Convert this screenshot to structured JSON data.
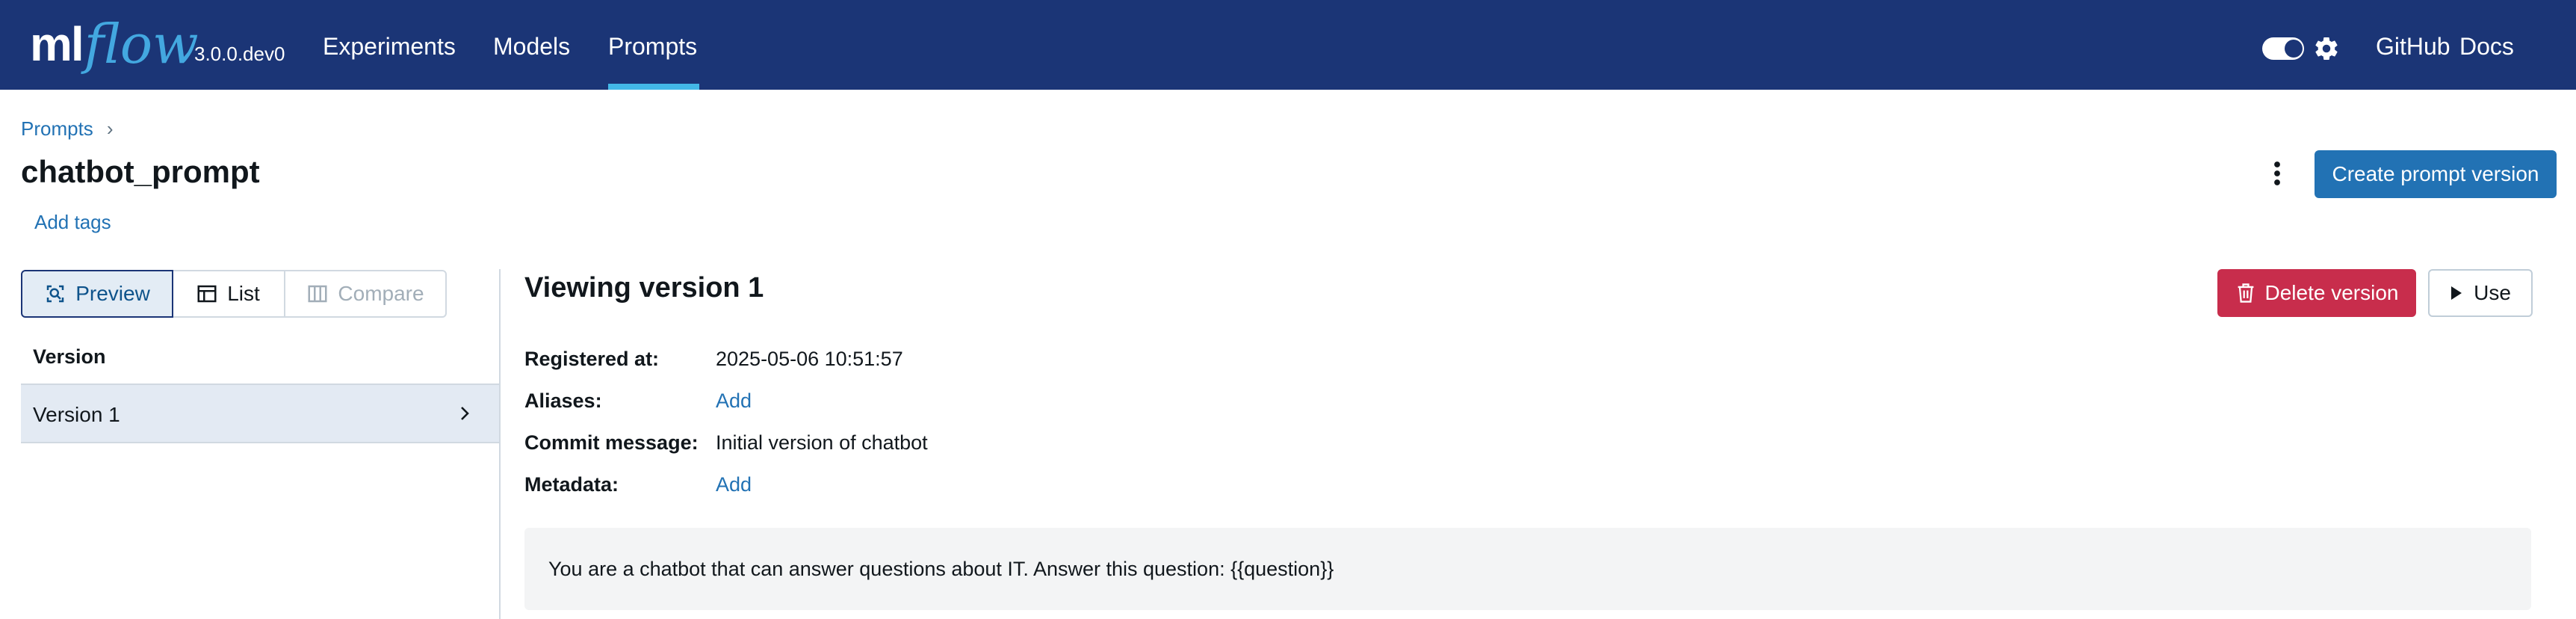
{
  "header": {
    "logo_ml": "ml",
    "logo_flow": "flow",
    "version": "3.0.0.dev0",
    "nav": [
      {
        "label": "Experiments"
      },
      {
        "label": "Models"
      },
      {
        "label": "Prompts",
        "active": true
      }
    ],
    "theme_toggle_icon": "toggle-switch",
    "settings_icon": "gear-icon",
    "github_label": "GitHub",
    "docs_label": "Docs"
  },
  "page": {
    "breadcrumb": "Prompts",
    "breadcrumb_separator": "›",
    "title": "chatbot_prompt",
    "add_tags_label": "Add tags",
    "more_icon": "kebab-vertical-icon",
    "create_button_label": "Create prompt version"
  },
  "left_panel": {
    "modes": [
      {
        "label": "Preview",
        "icon": "magnify-doc-icon",
        "selected": true
      },
      {
        "label": "List",
        "icon": "table-icon"
      },
      {
        "label": "Compare",
        "icon": "columns-icon",
        "disabled": true
      }
    ],
    "column_header": "Version",
    "versions": [
      {
        "label": "Version 1",
        "selected": true
      }
    ]
  },
  "right_panel": {
    "title": "Viewing version 1",
    "delete_button_label": "Delete version",
    "use_button_label": "Use",
    "fields": {
      "registered_label": "Registered at:",
      "registered_value": "2025-05-06 10:51:57",
      "aliases_label": "Aliases:",
      "aliases_action": "Add",
      "commit_label": "Commit message:",
      "commit_value": "Initial version of chatbot",
      "metadata_label": "Metadata:",
      "metadata_action": "Add"
    },
    "prompt_template": "You are a chatbot that can answer questions about IT. Answer this question: {{question}}"
  },
  "colors": {
    "header_bg": "#1b3576",
    "accent_blue": "#2272b4",
    "nav_underline": "#43b8e7",
    "danger": "#c82d4c",
    "selected_row": "#e3eaf3"
  }
}
